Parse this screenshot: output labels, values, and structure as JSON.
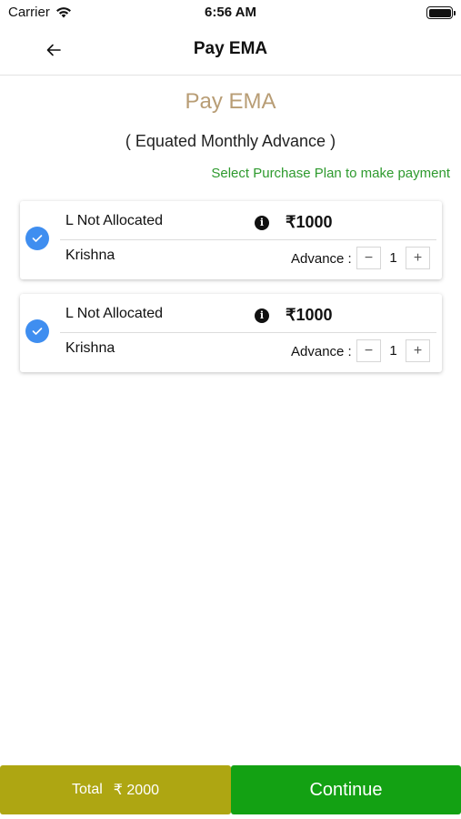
{
  "status_bar": {
    "carrier": "Carrier",
    "time": "6:56 AM"
  },
  "nav": {
    "title": "Pay EMA",
    "back_icon": "arrow-left-icon"
  },
  "page": {
    "heading": "Pay EMA",
    "subheading": "( Equated Monthly Advance )",
    "select_hint": "Select Purchase Plan to make payment"
  },
  "plans": [
    {
      "title": "L Not Allocated",
      "amount": "₹1000",
      "name": "Krishna",
      "advance_label": "Advance :",
      "quantity": "1",
      "selected": true
    },
    {
      "title": "L Not Allocated",
      "amount": "₹1000",
      "name": "Krishna",
      "advance_label": "Advance :",
      "quantity": "1",
      "selected": true
    }
  ],
  "footer": {
    "total_label": "Total",
    "total_value": "₹ 2000",
    "continue_label": "Continue"
  },
  "colors": {
    "accent_blue": "#3f8ef0",
    "heading_tan": "#b89d75",
    "hint_green": "#2e9a2e",
    "total_olive": "#aea612",
    "continue_green": "#13a113"
  },
  "icons": {
    "plus": "+",
    "minus": "−",
    "info": "i"
  }
}
